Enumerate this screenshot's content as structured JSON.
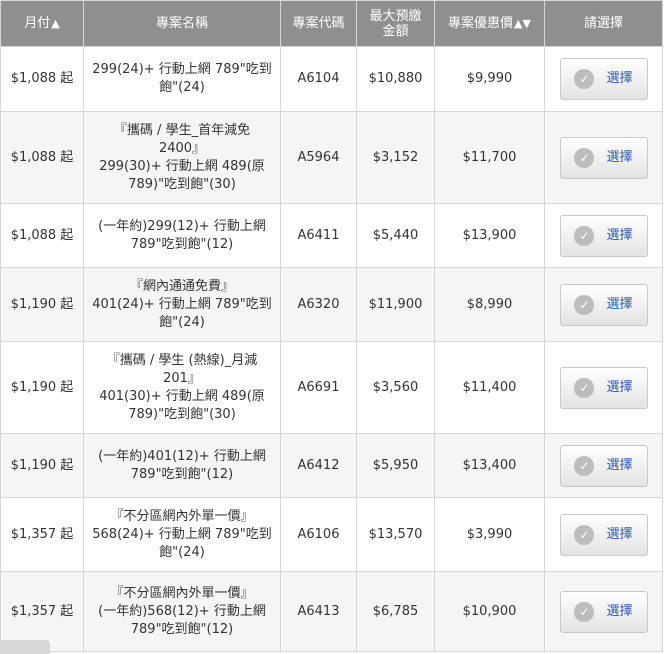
{
  "headers": {
    "monthly": "月付",
    "monthly_sort": "▲",
    "plan_name": "專案名稱",
    "plan_code": "專案代碼",
    "max_prepay": "最大預繳\n金額",
    "discount_price": "專案優惠價",
    "discount_sort": "▲▼",
    "select": "請選擇"
  },
  "button_label": "選擇",
  "icons": {
    "check": "check-circle-icon"
  },
  "colors": {
    "header_bg": "#8f8f8f",
    "price_red": "#c8102e",
    "button_text": "#2b5aa8"
  },
  "rows": [
    {
      "monthly": "$1,088 起",
      "name": "299(24)+ 行動上網 789\"吃到\n飽\"(24)",
      "code": "A6104",
      "prepay": "$10,880",
      "price": "$9,990"
    },
    {
      "monthly": "$1,088 起",
      "name": "『攜碼 / 學生_首年減免\n2400』\n299(30)+ 行動上網 489(原\n789)\"吃到飽\"(30)",
      "code": "A5964",
      "prepay": "$3,152",
      "price": "$11,700"
    },
    {
      "monthly": "$1,088 起",
      "name": "(一年約)299(12)+ 行動上網\n789\"吃到飽\"(12)",
      "code": "A6411",
      "prepay": "$5,440",
      "price": "$13,900"
    },
    {
      "monthly": "$1,190 起",
      "name": "『網內通通免費』\n401(24)+ 行動上網 789\"吃到\n飽\"(24)",
      "code": "A6320",
      "prepay": "$11,900",
      "price": "$8,990"
    },
    {
      "monthly": "$1,190 起",
      "name": "『攜碼 / 學生 (熱線)_月減\n201』\n401(30)+ 行動上網 489(原\n789)\"吃到飽\"(30)",
      "code": "A6691",
      "prepay": "$3,560",
      "price": "$11,400"
    },
    {
      "monthly": "$1,190 起",
      "name": "(一年約)401(12)+ 行動上網\n789\"吃到飽\"(12)",
      "code": "A6412",
      "prepay": "$5,950",
      "price": "$13,400"
    },
    {
      "monthly": "$1,357 起",
      "name": "『不分區網內外單一價』\n568(24)+ 行動上網 789\"吃到\n飽\"(24)",
      "code": "A6106",
      "prepay": "$13,570",
      "price": "$3,990"
    },
    {
      "monthly": "$1,357 起",
      "name": "『不分區網內外單一價』\n(一年約)568(12)+ 行動上網\n789\"吃到飽\"(12)",
      "code": "A6413",
      "prepay": "$6,785",
      "price": "$10,900"
    }
  ]
}
